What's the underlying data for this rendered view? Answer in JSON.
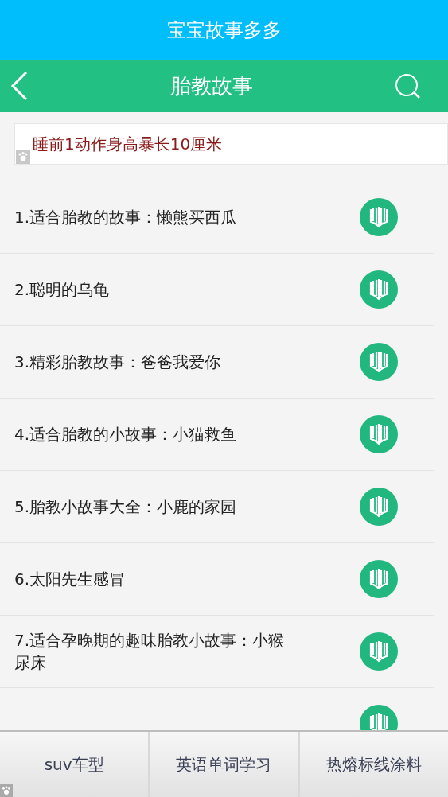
{
  "app_title": "宝宝故事多多",
  "header": {
    "title": "胎教故事"
  },
  "ad_banner": {
    "text": "睡前1动作身高暴长10厘米"
  },
  "stories": [
    {
      "title": "1.适合胎教的故事：懒熊买西瓜"
    },
    {
      "title": "2.聪明的乌龟"
    },
    {
      "title": "3.精彩胎教故事：爸爸我爱你"
    },
    {
      "title": "4.适合胎教的小故事：小猫救鱼"
    },
    {
      "title": "5.胎教小故事大全：小鹿的家园"
    },
    {
      "title": "6.太阳先生感冒"
    },
    {
      "title": "7.适合孕晚期的趣味胎教小故事：小猴尿床"
    }
  ],
  "bottom_links": [
    "suv车型",
    "英语单词学习",
    "热熔标线涂料"
  ]
}
